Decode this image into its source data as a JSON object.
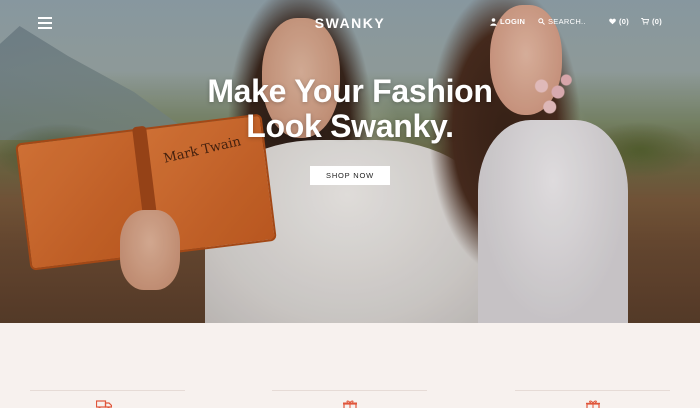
{
  "brand": {
    "logo": "SWANKY"
  },
  "nav": {
    "login": "LOGIN",
    "search": "SEARCH..",
    "wishlist_count": "(0)",
    "cart_count": "(0)"
  },
  "hero": {
    "headline_line1": "Make Your Fashion",
    "headline_line2": "Look Swanky.",
    "cta": "SHOP NOW",
    "book_title": "Mark Twain"
  },
  "icons": {
    "menu": "hamburger-icon",
    "login": "user-icon",
    "search": "search-icon",
    "wishlist": "heart-icon",
    "cart": "cart-icon",
    "feature1": "delivery-truck-icon",
    "feature2": "gift-box-icon",
    "feature3": "gift-icon"
  },
  "colors": {
    "accent": "#e0553a",
    "background": "#f7f1ee"
  }
}
